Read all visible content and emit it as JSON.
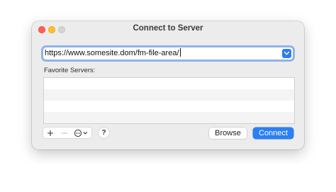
{
  "window": {
    "title": "Connect to Server"
  },
  "address": {
    "value": "https://www.somesite.dom/fm-file-area/"
  },
  "favorites": {
    "label": "Favorite Servers:",
    "items": []
  },
  "toolbar": {
    "add_icon": "plus-icon",
    "remove_icon": "minus-icon",
    "action_icon": "ellipsis-circle-icon",
    "help_label": "?"
  },
  "buttons": {
    "browse_label": "Browse",
    "connect_label": "Connect"
  },
  "colors": {
    "accent": "#2b7ff5",
    "close": "#fe5f57",
    "minimize": "#febc2e",
    "zoom_disabled": "#d3d3d3"
  }
}
